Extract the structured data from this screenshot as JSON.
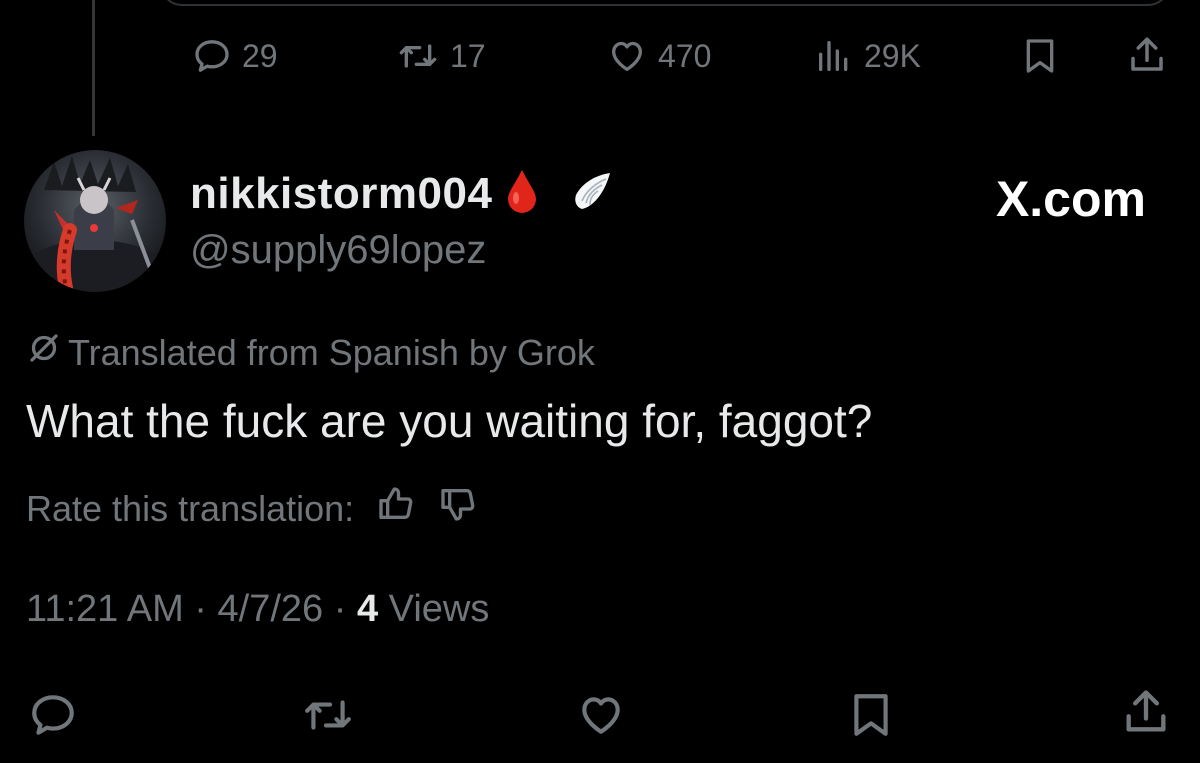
{
  "previous_tweet": {
    "actions": {
      "replies": "29",
      "reposts": "17",
      "likes": "470",
      "views": "29K"
    },
    "icons": [
      "reply-icon",
      "repost-icon",
      "like-icon",
      "views-icon",
      "bookmark-icon",
      "share-icon"
    ]
  },
  "tweet": {
    "display_name": "nikkistorm004",
    "badges": [
      "blood-drop-emoji",
      "wing-emoji"
    ],
    "handle": "@supply69lopez",
    "brand": "X.com",
    "translation_notice": "Translated from Spanish by Grok",
    "text": "What the fuck are you waiting for, faggot?",
    "rate_label": "Rate this translation:",
    "time": "11:21 AM",
    "date": "4/7/26",
    "views_count": "4",
    "views_label": "Views",
    "separator": "·"
  },
  "action_bar": {
    "icons": [
      "reply-icon",
      "repost-icon",
      "like-icon",
      "bookmark-icon",
      "share-icon"
    ]
  },
  "colors": {
    "background": "#000000",
    "primary_text": "#e7e9ea",
    "secondary_text": "#71767b",
    "drop_red": "#e0251b"
  }
}
